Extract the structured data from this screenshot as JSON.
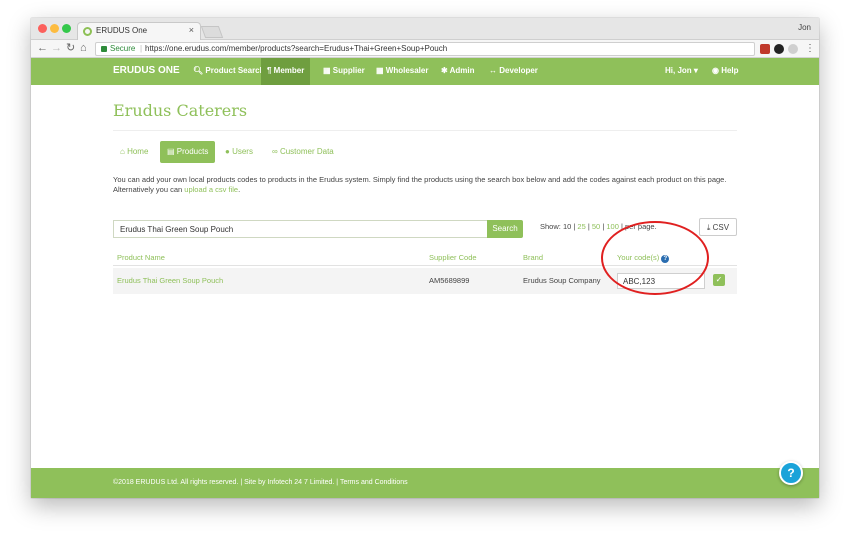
{
  "browser": {
    "tab_title": "ERUDUS One",
    "tab_close": "×",
    "profile": "Jon",
    "secure_label": "Secure",
    "separator": "|",
    "url": "https://one.erudus.com/member/products?search=Erudus+Thai+Green+Soup+Pouch",
    "menu": "⋮"
  },
  "navbar": {
    "brand": "ERUDUS ONE",
    "items": [
      "Product Search",
      "Member",
      "Supplier",
      "Wholesaler",
      "Admin",
      "Developer"
    ],
    "user": "Hi, Jon ▾",
    "help": "Help"
  },
  "page": {
    "title": "Erudus Caterers",
    "tabs": [
      "Home",
      "Products",
      "Users",
      "Customer Data"
    ],
    "description": "You can add your own local products codes to products in the Erudus system. Simply find the products using the search box below and add the codes against each product on this page.",
    "description_line2": "Alternatively you can ",
    "upload_link": "upload a csv file",
    "period": "."
  },
  "search": {
    "value": "Erudus Thai Green Soup Pouch",
    "button": "Search",
    "show_label": "Show:",
    "page_sizes": [
      "10",
      "25",
      "50",
      "100"
    ],
    "per_page": "per page."
  },
  "csv_button": "CSV",
  "table": {
    "headers": [
      "Product Name",
      "Supplier Code",
      "Brand",
      "Your code(s)"
    ],
    "rows": [
      {
        "name": "Erudus Thai Green Soup Pouch",
        "supplier_code": "AM5689899",
        "brand": "Erudus Soup Company",
        "code": "ABC,123"
      }
    ]
  },
  "footer": "©2018 ERUDUS Ltd. All rights reserved. | Site by Infotech 24 7 Limited. | Terms and Conditions",
  "help_bubble": "?",
  "colors": {
    "brand_green": "#8fc05a",
    "active_green": "#6f9e3f",
    "annotation_red": "#e02020",
    "help_blue": "#1aa3d9"
  }
}
